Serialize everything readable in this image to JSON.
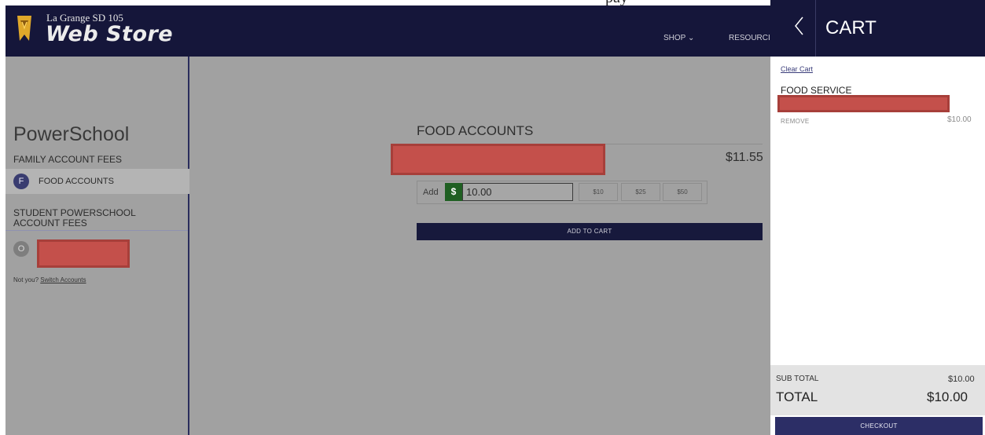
{
  "top_strip_text": "pay",
  "header": {
    "logo_small": "La Grange SD 105",
    "logo_big": "Web Store",
    "nav": {
      "shop": "SHOP",
      "resources": "RESOURCI"
    }
  },
  "sidebar": {
    "title": "PowerSchool",
    "family_fees_heading": "FAMILY ACCOUNT FEES",
    "food_badge": "F",
    "food_label": "FOOD ACCOUNTS",
    "student_fees_heading": "STUDENT POWERSCHOOL ACCOUNT FEES",
    "student_badge": "O",
    "not_you_text": "Not you?",
    "switch_accounts": "Switch Accounts"
  },
  "main": {
    "section_title": "FOOD ACCOUNTS",
    "balance": "$11.55",
    "add_label": "Add",
    "currency_symbol": "$",
    "amount_value": "10.00",
    "presets": [
      "$10",
      "$25",
      "$50"
    ],
    "add_to_cart": "ADD TO CART"
  },
  "cart": {
    "title": "CART",
    "clear_cart": "Clear Cart",
    "category": "FOOD SERVICE",
    "remove": "REMOVE",
    "item_price": "$10.00",
    "subtotal_label": "SUB TOTAL",
    "subtotal_value": "$10.00",
    "total_label": "TOTAL",
    "total_value": "$10.00",
    "checkout": "CHECKOUT"
  },
  "colors": {
    "header_bg": "#15163a",
    "overlay_bg": "#a1a1a1",
    "redaction": "#c4504b",
    "dollar_chip": "#1f5f22",
    "checkout_bg": "#2c2e66"
  }
}
